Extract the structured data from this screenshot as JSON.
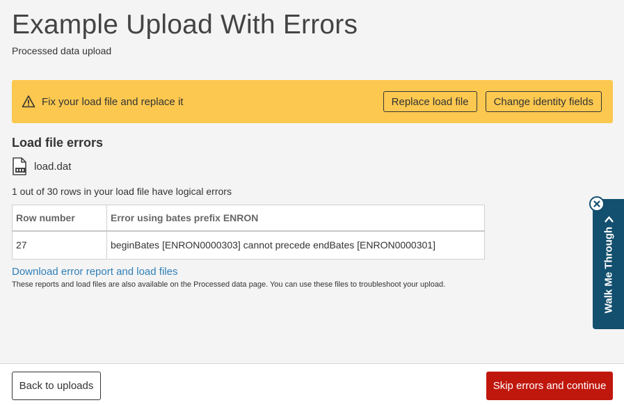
{
  "header": {
    "title": "Example Upload With Errors",
    "subtitle": "Processed data upload"
  },
  "alert": {
    "icon": "warning-icon",
    "message": "Fix your load file and replace it",
    "replace_label": "Replace load file",
    "change_label": "Change identity fields",
    "background_color": "#fcc84f"
  },
  "errors_section": {
    "title": "Load file errors",
    "file_icon": "dat-file-icon",
    "file_name": "load.dat",
    "summary": "1 out of 30 rows in your load file have logical errors",
    "table": {
      "columns": [
        "Row number",
        "Error using bates prefix ENRON"
      ],
      "rows": [
        {
          "row_number": "27",
          "error": "beginBates [ENRON0000303] cannot precede endBates [ENRON0000301]"
        }
      ]
    },
    "download_link": "Download error report and load files",
    "note": "These reports and load files are also available on the Processed data page. You can use these files to troubleshoot your upload."
  },
  "footer": {
    "back_label": "Back to uploads",
    "skip_label": "Skip errors and continue",
    "skip_color": "#c0170d"
  },
  "walkme": {
    "label": "Walk Me Through",
    "chevron_icon": "chevron-right-icon",
    "close_icon": "close-icon",
    "background_color": "#134f6e"
  }
}
